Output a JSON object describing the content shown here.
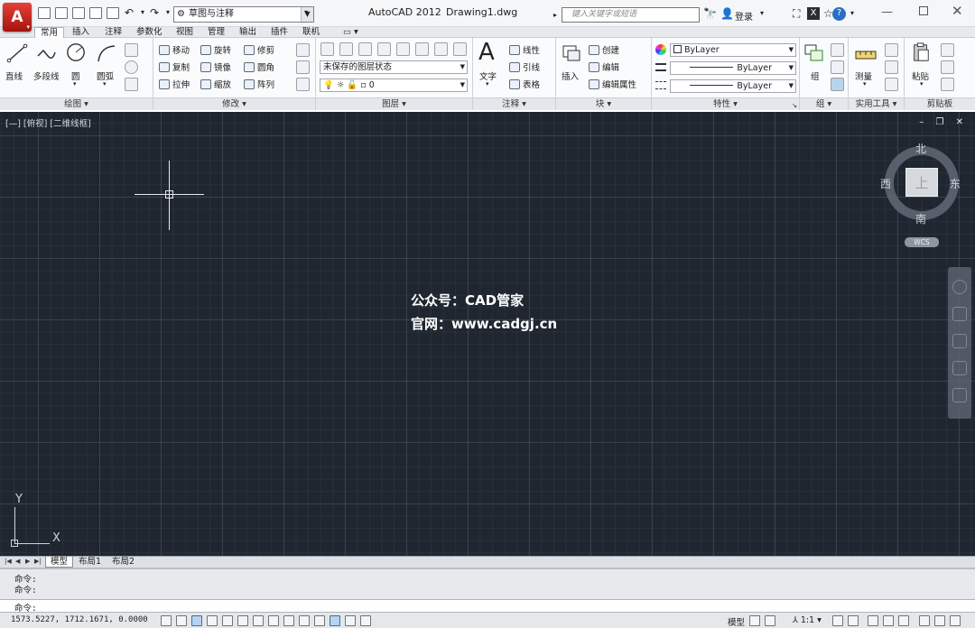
{
  "titlebar": {
    "logo_glyph": "A",
    "workspace": "草图与注释",
    "app_title": "AutoCAD 2012",
    "doc_title": "Drawing1.dwg",
    "search_placeholder": "键入关键字或短语",
    "login_label": "登录"
  },
  "ribbon_tabs": [
    "常用",
    "插入",
    "注释",
    "参数化",
    "视图",
    "管理",
    "输出",
    "插件",
    "联机"
  ],
  "ribbon_tabs_active": "常用",
  "draw": {
    "title": "绘图 ▾",
    "line": "直线",
    "polyline": "多段线",
    "circle": "圆",
    "arc": "圆弧"
  },
  "modify": {
    "title": "修改 ▾",
    "move": "移动",
    "rotate": "旋转",
    "trim": "修剪",
    "copy": "复制",
    "mirror": "镜像",
    "fillet": "圆角",
    "stretch": "拉伸",
    "scale": "缩放",
    "array": "阵列"
  },
  "layers": {
    "title": "图层 ▾",
    "state": "未保存的图层状态",
    "current_layer": "0"
  },
  "annotation": {
    "title": "注释 ▾",
    "text": "文字",
    "linear": "线性",
    "leader": "引线",
    "table": "表格"
  },
  "block": {
    "title": "块 ▾",
    "insert": "插入",
    "create": "创建",
    "edit": "编辑",
    "edit_attr": "编辑属性"
  },
  "properties": {
    "title": "特性 ▾",
    "color": "ByLayer",
    "linetype": "ByLayer",
    "lineweight": "ByLayer"
  },
  "groups": {
    "title": "组 ▾",
    "group": "组"
  },
  "utilities": {
    "title": "实用工具 ▾",
    "measure": "测量"
  },
  "clipboard": {
    "title": "剪贴板",
    "paste": "粘贴"
  },
  "viewport": {
    "label": "[—] [俯视] [二维线框]",
    "controls": "– ❐ ✕"
  },
  "watermark": {
    "line1": "公众号：CAD管家",
    "line2": "官网：www.cadgj.cn"
  },
  "viewcube": {
    "top": "上",
    "north": "北",
    "south": "南",
    "east": "东",
    "west": "西",
    "wcs": "WCS"
  },
  "ucs": {
    "x": "X",
    "y": "Y"
  },
  "layout_tabs": [
    "模型",
    "布局1",
    "布局2"
  ],
  "layout_tabs_active": "模型",
  "command": {
    "history": [
      "命令:",
      "命令:"
    ],
    "prompt": "命令:"
  },
  "status": {
    "coords": "1573.5227,  1712.1671,  0.0000",
    "model": "模型",
    "scale": "⅄ 1:1 ▾"
  }
}
